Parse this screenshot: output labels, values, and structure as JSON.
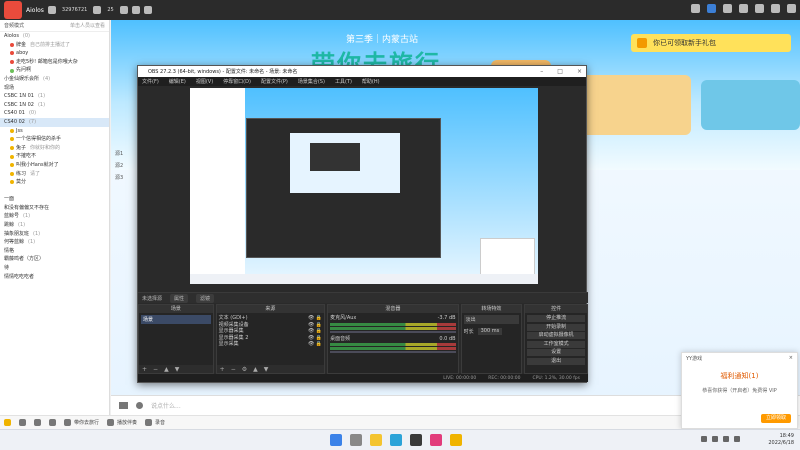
{
  "topbar": {
    "username": "Aiolos",
    "id": "32976721",
    "followers": "25"
  },
  "sidebar": {
    "mode_label": "音频模式",
    "head_link": "单击人员以查看",
    "rows": [
      {
        "text": "Aiolos",
        "extra": "(0)",
        "indent": false
      },
      {
        "text": "牌金",
        "extra": "自己前排主播过了",
        "indent": true,
        "dot": "r"
      },
      {
        "text": "aboy",
        "extra": "",
        "indent": true,
        "dot": "r"
      },
      {
        "text": "走吃5秒! 邮箱包是你哦大杂",
        "extra": "",
        "indent": true,
        "dot": "r"
      },
      {
        "text": "先问啊",
        "extra": "",
        "indent": true,
        "dot": "g"
      },
      {
        "text": "小金仙娱乐会所",
        "extra": "(4)",
        "indent": false
      },
      {
        "text": "现场",
        "extra": "",
        "indent": false
      },
      {
        "text": "CSBC 1N 01",
        "extra": "(1)",
        "indent": false
      },
      {
        "text": "CSBC 1N 02",
        "extra": "(1)",
        "indent": false
      },
      {
        "text": "CS40 01",
        "extra": "(0)",
        "indent": false
      },
      {
        "text": "CS40 02",
        "extra": "(7)",
        "indent": false,
        "sel": true
      },
      {
        "text": "Jss",
        "extra": "",
        "indent": true,
        "dot": "y"
      },
      {
        "text": "一个信得相信的杀手",
        "extra": "",
        "indent": true,
        "dot": "y"
      },
      {
        "text": "兔子",
        "extra": "你就好和你的",
        "indent": true,
        "dot": "y"
      },
      {
        "text": "不摧吃不",
        "extra": "",
        "indent": true,
        "dot": "y"
      },
      {
        "text": "叫我小Hans就对了",
        "extra": "",
        "indent": true,
        "dot": "y"
      },
      {
        "text": "练习",
        "extra": "请了",
        "indent": true,
        "dot": "y"
      },
      {
        "text": "莫分",
        "extra": "",
        "indent": true,
        "dot": "y"
      },
      {
        "text": "",
        "extra": "",
        "indent": false
      },
      {
        "text": "一面",
        "extra": "",
        "indent": false
      },
      {
        "text": "和没有偏偏又不存在",
        "extra": "",
        "indent": false
      },
      {
        "text": "蓝鲸号",
        "extra": "(1)",
        "indent": false
      },
      {
        "text": "跳鲸",
        "extra": "(1)",
        "indent": false
      },
      {
        "text": "抽象朋友班",
        "extra": "(1)",
        "indent": false
      },
      {
        "text": "何等蓝鲸",
        "extra": "(1)",
        "indent": false
      },
      {
        "text": "情格",
        "extra": "",
        "indent": false
      },
      {
        "text": "霸藤鸣者（方区）",
        "extra": "",
        "indent": false
      },
      {
        "text": "待",
        "extra": "",
        "indent": false
      },
      {
        "text": "情情吃吃吃者",
        "extra": "",
        "indent": false
      }
    ]
  },
  "stream": {
    "banner_sub": "第三季｜内蒙古站",
    "banner_main": "带你去旅行",
    "gift_text": "你已可领取新手礼包",
    "side_labels": [
      "源1",
      "源2",
      "源3"
    ]
  },
  "obs": {
    "title": "OBS 27.2.3 (64-bit, windows) - 配置文件: 未命名 - 场景: 未命名",
    "menu": [
      "文件(F)",
      "编辑(E)",
      "视图(V)",
      "停靠窗口(D)",
      "配置文件(P)",
      "场景集合(S)",
      "工具(T)",
      "帮助(H)"
    ],
    "toolbar": [
      "未选择源",
      "属性",
      "滤镜"
    ],
    "scenes_title": "场景",
    "scene_name": "场景",
    "sources_title": "来源",
    "sources": [
      "文本 (GDI+)",
      "视频采集设备",
      "显示器采集",
      "显示器采集 2",
      "显示采集"
    ],
    "mixer_title": "混音器",
    "mixer": [
      {
        "name": "麦克风/Aux",
        "db": "-3.7 dB"
      },
      {
        "name": "桌面音频",
        "db": "0.0 dB"
      }
    ],
    "transition_title": "转场特效",
    "transition_mode": "淡出",
    "duration_label": "时长",
    "duration_value": "300 ms",
    "controls_title": "控件",
    "controls": [
      "停止推流",
      "开始录制",
      "启动虚拟摄像机",
      "工作室模式",
      "设置",
      "退出"
    ],
    "status": [
      "LIVE: 00:00:00",
      "REC: 00:00:00",
      "CPU: 1.2%, 30.00 fps"
    ]
  },
  "chatbar": {
    "placeholder": "说点什么..."
  },
  "bottombar": {
    "items": [
      "带你去旅行",
      "播放伴奏",
      "录音"
    ]
  },
  "popup": {
    "header": "YY游戏",
    "title": "福利通知(1)",
    "body": "恭喜你获得（开启者）免费得 VIP",
    "button": "立即领取"
  },
  "taskbar": {
    "time": "18:49",
    "date": "2022/6/18"
  }
}
